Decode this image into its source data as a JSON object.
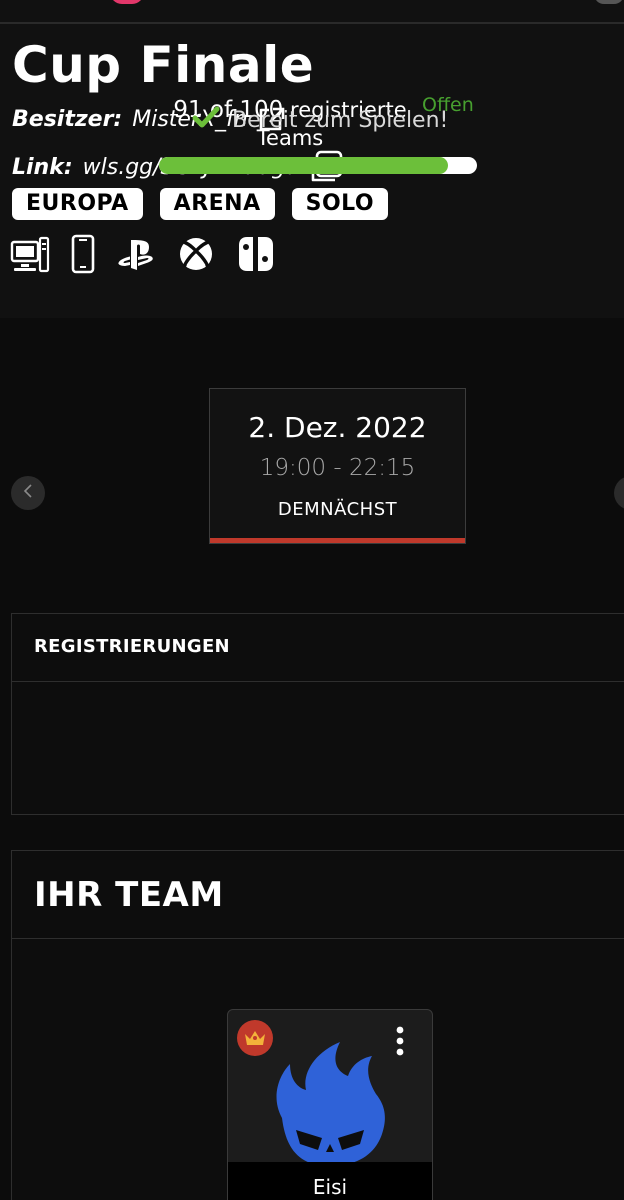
{
  "tournament": {
    "title": "Cup Finale",
    "owner_label": "Besitzer:",
    "owner_name": "MisterX_fn",
    "link_label": "Link:",
    "link_value": "wls.gg/SGLJXwudgu",
    "tags": [
      "EUROPA",
      "ARENA",
      "SOLO"
    ],
    "platform_icons": [
      "pc-icon",
      "mobile-icon",
      "playstation-icon",
      "xbox-icon",
      "switch-icon"
    ]
  },
  "session": {
    "date": "2. Dez. 2022",
    "time": "19:00 - 22:15",
    "status": "DEMNÄCHST",
    "status_color": "#c0392b"
  },
  "registrations": {
    "heading": "REGISTRIERUNGEN",
    "count_text": "91 of 100",
    "suffix_line1": "registrierte",
    "suffix_line2": "Teams",
    "registered": 91,
    "capacity": 100,
    "state": "Offen",
    "state_color": "#47a02f",
    "bar_color": "#6cbf3a"
  },
  "team": {
    "heading": "IHR TEAM",
    "ready_text": "Bereit zum Spielen!",
    "player_name": "Eisi",
    "avatar_color": "#2f62d8"
  }
}
